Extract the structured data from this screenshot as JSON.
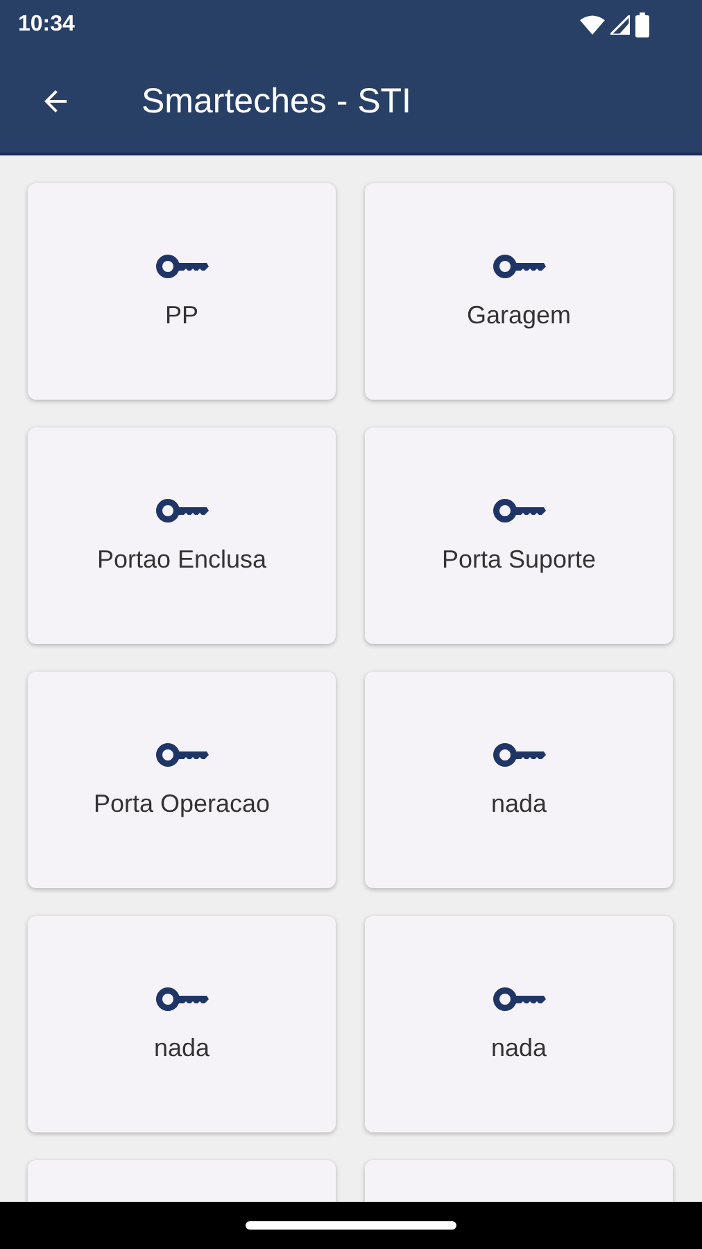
{
  "status_bar": {
    "time": "10:34"
  },
  "app_bar": {
    "title": "Smarteches - STI"
  },
  "tiles": [
    {
      "kind": "key",
      "label": "PP"
    },
    {
      "kind": "key",
      "label": "Garagem"
    },
    {
      "kind": "key",
      "label": "Portao Enclusa"
    },
    {
      "kind": "key",
      "label": "Porta Suporte"
    },
    {
      "kind": "key",
      "label": "Porta Operacao"
    },
    {
      "kind": "key",
      "label": "nada"
    },
    {
      "kind": "key",
      "label": "nada"
    },
    {
      "kind": "key",
      "label": "nada"
    },
    {
      "kind": "partial"
    },
    {
      "kind": "partial"
    }
  ]
}
